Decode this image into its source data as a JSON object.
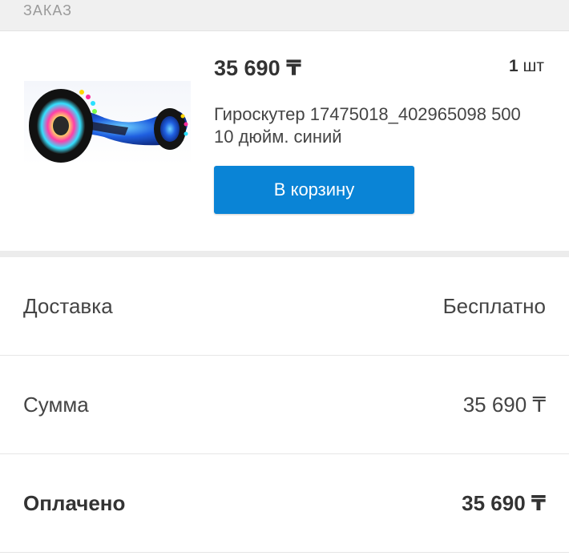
{
  "header": {
    "title": "ЗАКАЗ"
  },
  "product": {
    "price": "35 690 ₸",
    "qty_number": "1",
    "qty_unit": " шт",
    "title": "Гироскутер 17475018_402965098 500 10 дюйм. синий",
    "cart_button_label": "В корзину"
  },
  "summary": {
    "delivery_label": "Доставка",
    "delivery_value": "Бесплатно",
    "sum_label": "Сумма",
    "sum_value": "35 690 ₸",
    "paid_label": "Оплачено",
    "paid_value": "35 690 ₸"
  },
  "colors": {
    "accent": "#0a84d6",
    "text": "#333333",
    "header_bg": "#f0f0f0"
  }
}
